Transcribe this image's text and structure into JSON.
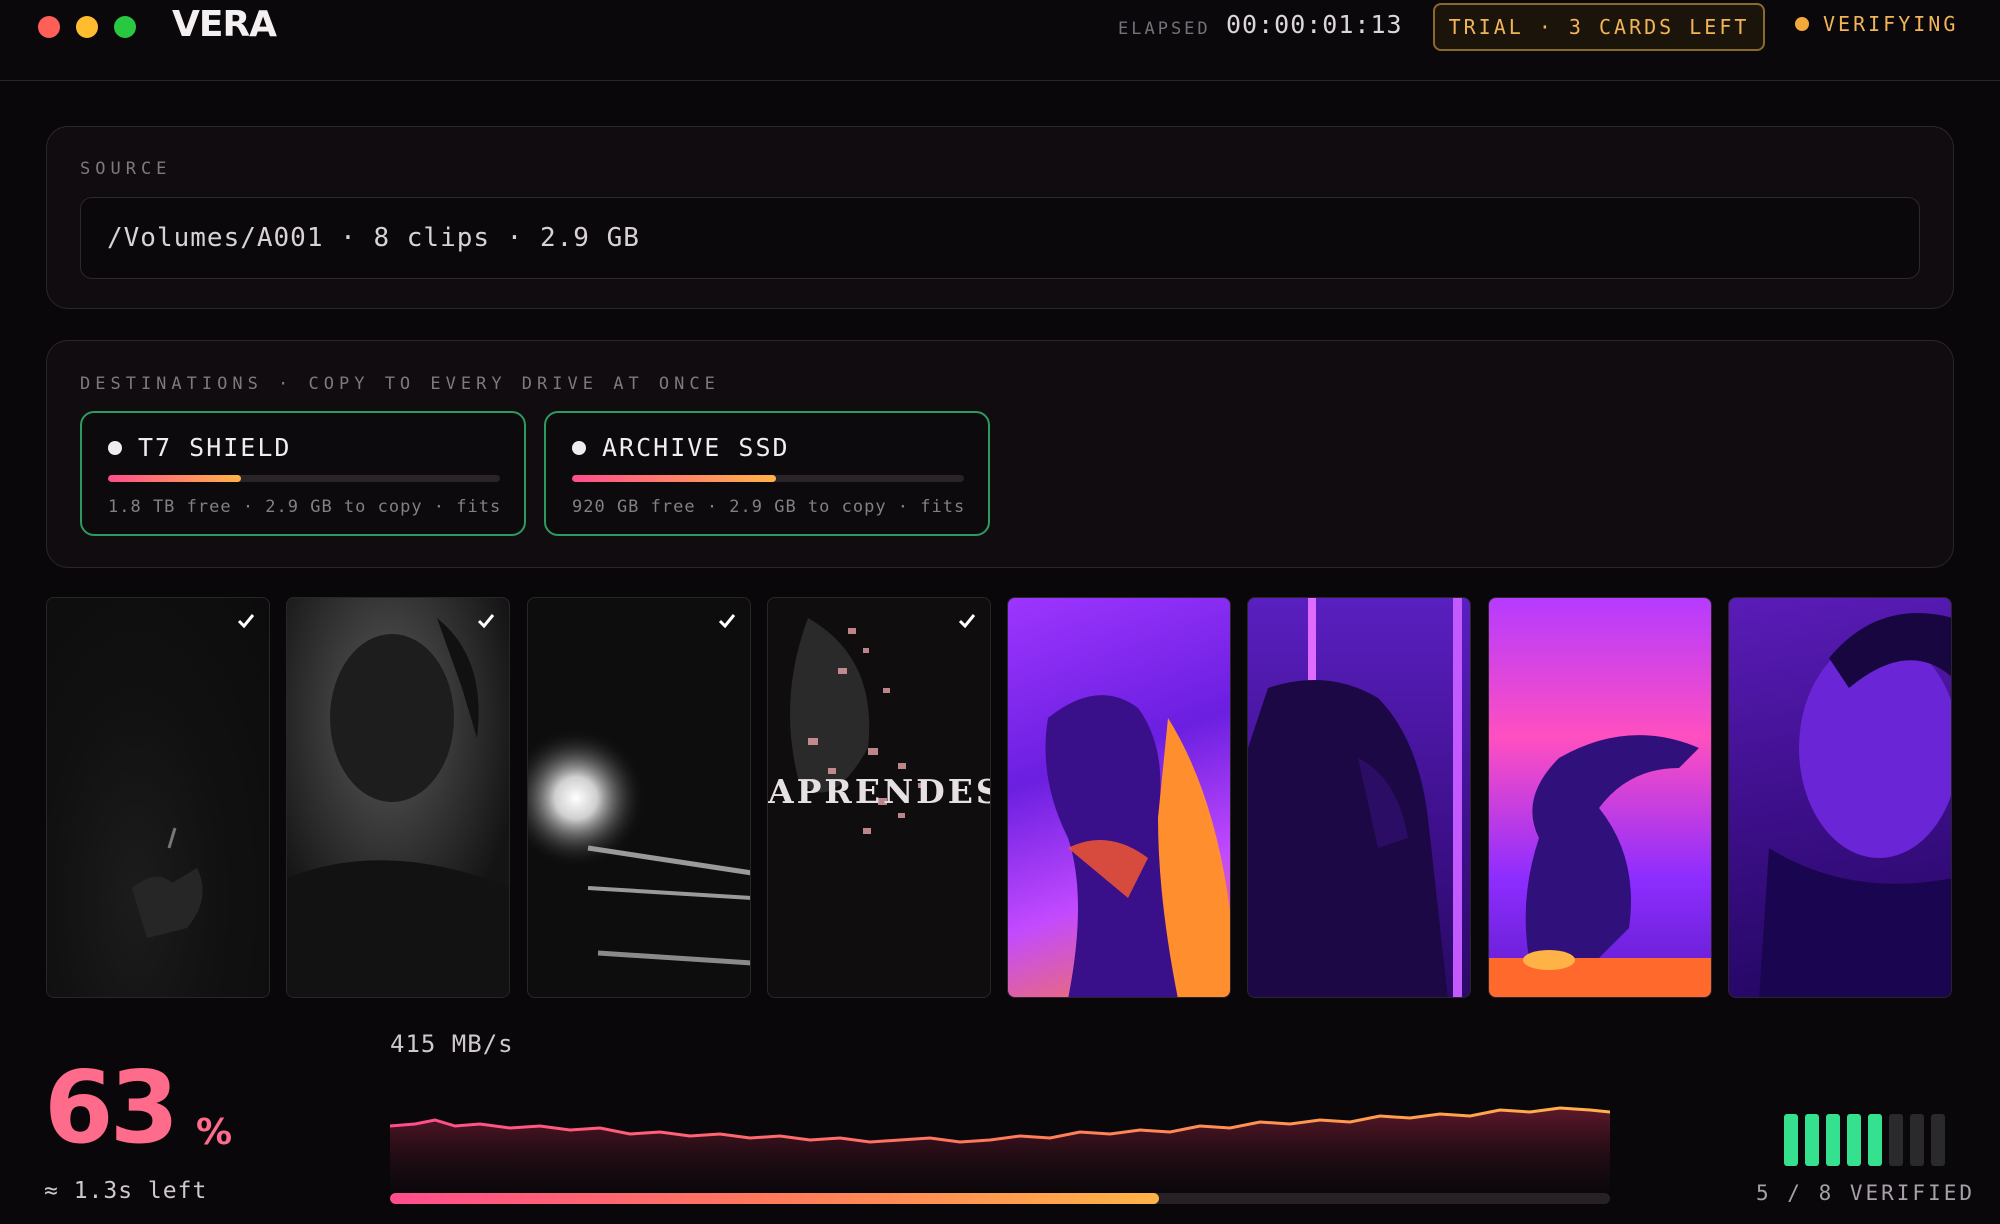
{
  "colors": {
    "accent_pink": "#ff4d8d",
    "accent_orange": "#ffb347",
    "trial_amber": "#f2b457",
    "verified_green": "#35e08e",
    "drive_border_green": "#2d9a5f",
    "traffic_red": "#ff5f57",
    "traffic_yellow": "#febc2e",
    "traffic_green": "#28c840"
  },
  "header": {
    "app_name": "VERA",
    "elapsed_label": "ELAPSED",
    "elapsed_value": "00:00:01:13",
    "trial_badge": "TRIAL · 3 CARDS LEFT",
    "status": "VERIFYING"
  },
  "source": {
    "label": "SOURCE",
    "value": "/Volumes/A001 · 8 clips · 2.9 GB"
  },
  "destinations": {
    "label": "DESTINATIONS · COPY TO EVERY DRIVE AT ONCE",
    "drives": [
      {
        "name": "T7 SHIELD",
        "info": "1.8 TB free · 2.9 GB to copy · fits",
        "fill": 0.34
      },
      {
        "name": "ARCHIVE SSD",
        "info": "920 GB free · 2.9 GB to copy · fits",
        "fill": 0.52
      }
    ]
  },
  "clips": [
    {
      "tone": "dark",
      "verified": true
    },
    {
      "tone": "mono",
      "verified": true
    },
    {
      "tone": "mono-light",
      "verified": true
    },
    {
      "tone": "mono-text",
      "verified": true,
      "overlay_text": "APRENDES"
    },
    {
      "tone": "thermal",
      "verified": false
    },
    {
      "tone": "thermal",
      "verified": false
    },
    {
      "tone": "thermal",
      "verified": false
    },
    {
      "tone": "purple",
      "verified": false
    }
  ],
  "progress": {
    "percent_value": "63",
    "percent_sign": "%",
    "time_left": "≈ 1.3s left",
    "speed": "415 MB/s",
    "fraction": 0.63
  },
  "verification": {
    "verified": 5,
    "total": 8,
    "text": "5 / 8 VERIFIED"
  }
}
